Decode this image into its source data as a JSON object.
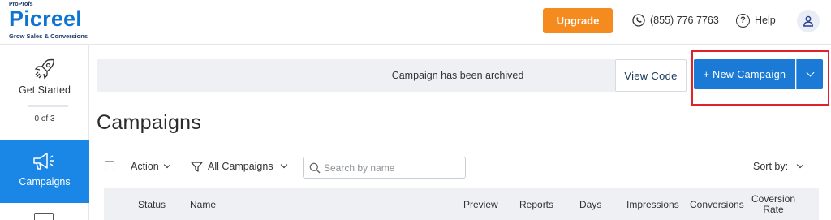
{
  "header": {
    "logo_super": "ProProfs",
    "logo_brand": "Picreel",
    "logo_tagline": "Grow Sales & Conversions",
    "upgrade_label": "Upgrade",
    "phone": "(855) 776 7763",
    "help_label": "Help",
    "help_icon": "?"
  },
  "sidebar": {
    "get_started_label": "Get Started",
    "progress_text": "0 of 3",
    "campaigns_label": "Campaigns"
  },
  "notice": {
    "message": "Campaign has been archived"
  },
  "actions": {
    "view_code_label": "View Code",
    "new_campaign_label": "+ New Campaign"
  },
  "page": {
    "title": "Campaigns"
  },
  "toolbar": {
    "action_label": "Action",
    "filter_label": "All Campaigns",
    "search_placeholder": "Search by name",
    "sort_label": "Sort by:"
  },
  "table": {
    "columns": {
      "status": "Status",
      "name": "Name",
      "preview": "Preview",
      "reports": "Reports",
      "days": "Days",
      "impressions": "Impressions",
      "conversions": "Conversions",
      "conversion_rate_line1": "Coversion",
      "conversion_rate_line2": "Rate"
    }
  },
  "colors": {
    "brand_blue": "#0d74d4",
    "primary_button": "#1a7ad6",
    "sidebar_active": "#1a86e6",
    "upgrade_orange": "#f58a1f",
    "highlight_red": "#e0232b"
  }
}
